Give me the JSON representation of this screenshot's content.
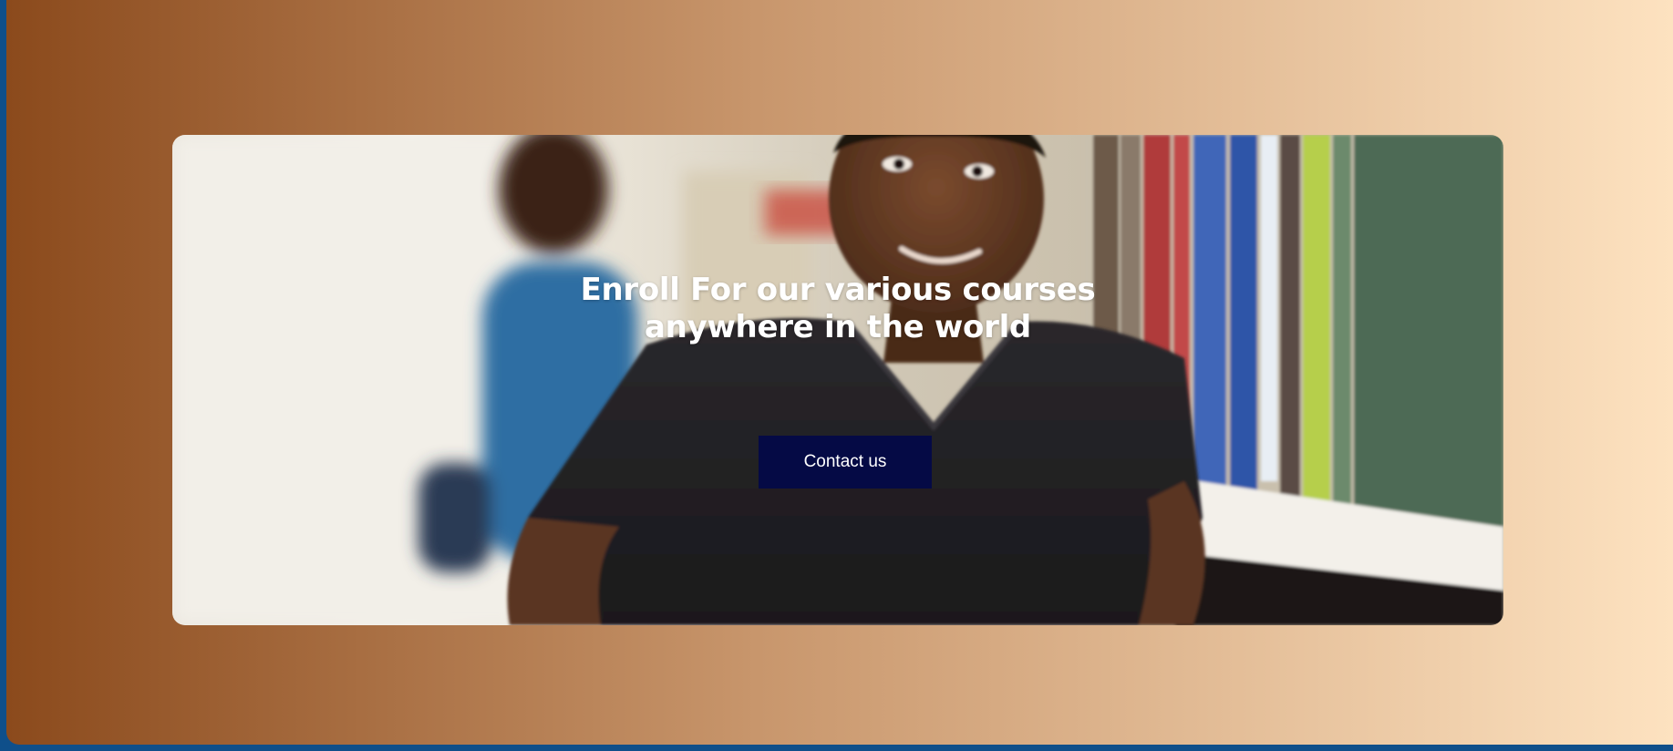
{
  "theme": {
    "frame_color": "#0f4f8a",
    "gradient_start": "#8b4a1c",
    "gradient_mid": "#c8966c",
    "gradient_end": "#fde2c0",
    "button_color": "#050a45"
  },
  "hero": {
    "heading_line_1": "Enroll For our various courses",
    "heading_line_2": "anywhere in the world",
    "button_label": "Contact us",
    "image_icon": "student-photo"
  }
}
